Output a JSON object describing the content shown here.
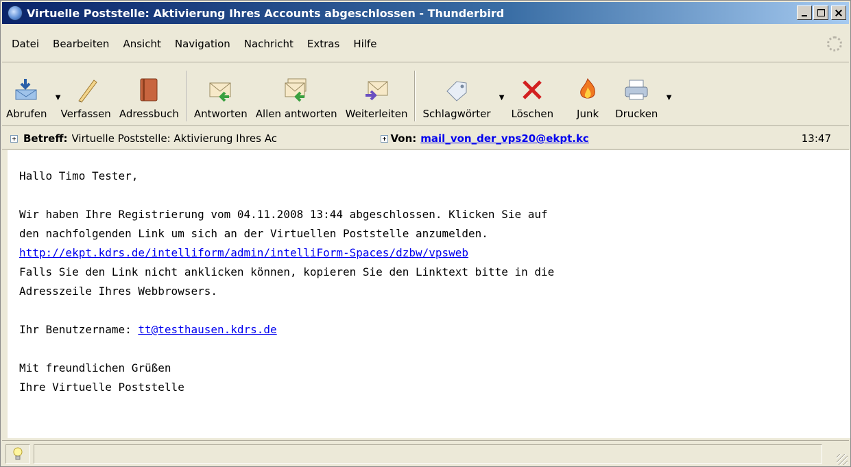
{
  "window": {
    "title": "Virtuelle Poststelle: Aktivierung Ihres Accounts abgeschlossen - Thunderbird"
  },
  "menu": {
    "items": [
      {
        "label": "Datei"
      },
      {
        "label": "Bearbeiten"
      },
      {
        "label": "Ansicht"
      },
      {
        "label": "Navigation"
      },
      {
        "label": "Nachricht"
      },
      {
        "label": "Extras"
      },
      {
        "label": "Hilfe"
      }
    ]
  },
  "toolbar": {
    "get_mail": "Abrufen",
    "compose": "Verfassen",
    "address_book": "Adressbuch",
    "reply": "Antworten",
    "reply_all": "Allen antworten",
    "forward": "Weiterleiten",
    "tags": "Schlagwörter",
    "delete": "Löschen",
    "junk": "Junk",
    "print": "Drucken"
  },
  "header": {
    "subject_label": "Betreff:",
    "subject_value": "Virtuelle Poststelle: Aktivierung Ihres Ac",
    "from_label": "Von:",
    "from_value": "mail_von_der_vps20@ekpt.kc",
    "time": "13:47"
  },
  "message": {
    "greeting": "Hallo Timo Tester,",
    "line1": "Wir haben Ihre Registrierung vom 04.11.2008 13:44 abgeschlossen. Klicken Sie auf",
    "line2": "den nachfolgenden Link um sich an der Virtuellen Poststelle anzumelden.",
    "link": "http://ekpt.kdrs.de/intelliform/admin/intelliForm-Spaces/dzbw/vpsweb",
    "line3": "Falls Sie den Link nicht anklicken können, kopieren Sie den Linktext bitte in die",
    "line4": "Adresszeile Ihres Webbrowsers.",
    "username_label": "Ihr Benutzername: ",
    "username_value": "tt@testhausen.kdrs.de",
    "closing1": "Mit freundlichen Grüßen",
    "closing2": "Ihre Virtuelle Poststelle"
  },
  "status": {
    "text": ""
  }
}
